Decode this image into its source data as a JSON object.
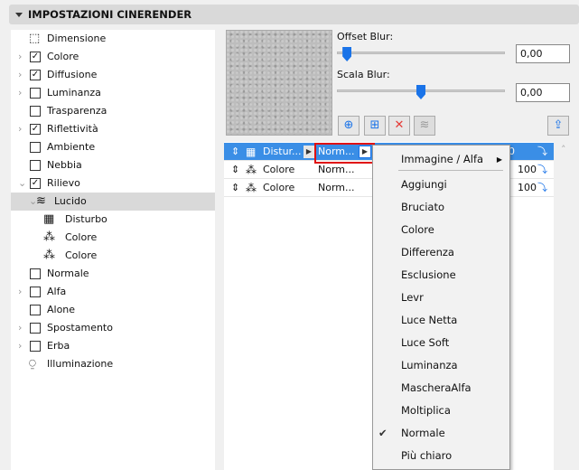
{
  "header": {
    "title": "IMPOSTAZIONI CINERENDER"
  },
  "tree": [
    {
      "label": "Dimensione",
      "check": null,
      "chevron": "",
      "indent": 0,
      "icon": "dimension-icon"
    },
    {
      "label": "Colore",
      "check": true,
      "chevron": "›",
      "indent": 0
    },
    {
      "label": "Diffusione",
      "check": true,
      "chevron": "›",
      "indent": 0
    },
    {
      "label": "Luminanza",
      "check": false,
      "chevron": "›",
      "indent": 0
    },
    {
      "label": "Trasparenza",
      "check": false,
      "chevron": "",
      "indent": 0
    },
    {
      "label": "Riflettività",
      "check": true,
      "chevron": "›",
      "indent": 0
    },
    {
      "label": "Ambiente",
      "check": false,
      "chevron": "",
      "indent": 0
    },
    {
      "label": "Nebbia",
      "check": false,
      "chevron": "",
      "indent": 0
    },
    {
      "label": "Rilievo",
      "check": true,
      "chevron": "⌄",
      "indent": 0
    },
    {
      "label": "Lucido",
      "check": null,
      "chevron": "⌄",
      "indent": 1,
      "icon": "layers-icon",
      "selected": true
    },
    {
      "label": "Disturbo",
      "check": null,
      "chevron": "",
      "indent": 2,
      "icon": "noise-icon"
    },
    {
      "label": "Colore",
      "check": null,
      "chevron": "",
      "indent": 2,
      "icon": "color-icon"
    },
    {
      "label": "Colore",
      "check": null,
      "chevron": "",
      "indent": 2,
      "icon": "color-icon"
    },
    {
      "label": "Normale",
      "check": false,
      "chevron": "",
      "indent": 0
    },
    {
      "label": "Alfa",
      "check": false,
      "chevron": "›",
      "indent": 0
    },
    {
      "label": "Alone",
      "check": false,
      "chevron": "",
      "indent": 0
    },
    {
      "label": "Spostamento",
      "check": false,
      "chevron": "›",
      "indent": 0
    },
    {
      "label": "Erba",
      "check": false,
      "chevron": "›",
      "indent": 0
    },
    {
      "label": "Illuminazione",
      "check": null,
      "chevron": "",
      "indent": 0,
      "icon": "light-icon"
    }
  ],
  "controls": {
    "offset_label": "Offset Blur:",
    "offset_value": "0,00",
    "offset_slider": 0.06,
    "scale_label": "Scala Blur:",
    "scale_value": "0,00",
    "scale_slider": 0.5
  },
  "layers": [
    {
      "name": "Distur...",
      "blend": "Norm...",
      "value": "0",
      "selected": true
    },
    {
      "name": "Colore",
      "blend": "Norm...",
      "value": "100"
    },
    {
      "name": "Colore",
      "blend": "Norm...",
      "value": "100"
    }
  ],
  "menu": {
    "submenu": "Immagine / Alfa",
    "items": [
      "Aggiungi",
      "Bruciato",
      "Colore",
      "Differenza",
      "Esclusione",
      "Levr",
      "Luce Netta",
      "Luce Soft",
      "Luminanza",
      "MascheraAlfa",
      "Moltiplica",
      "Normale",
      "Più chiaro"
    ],
    "checked": "Normale"
  }
}
